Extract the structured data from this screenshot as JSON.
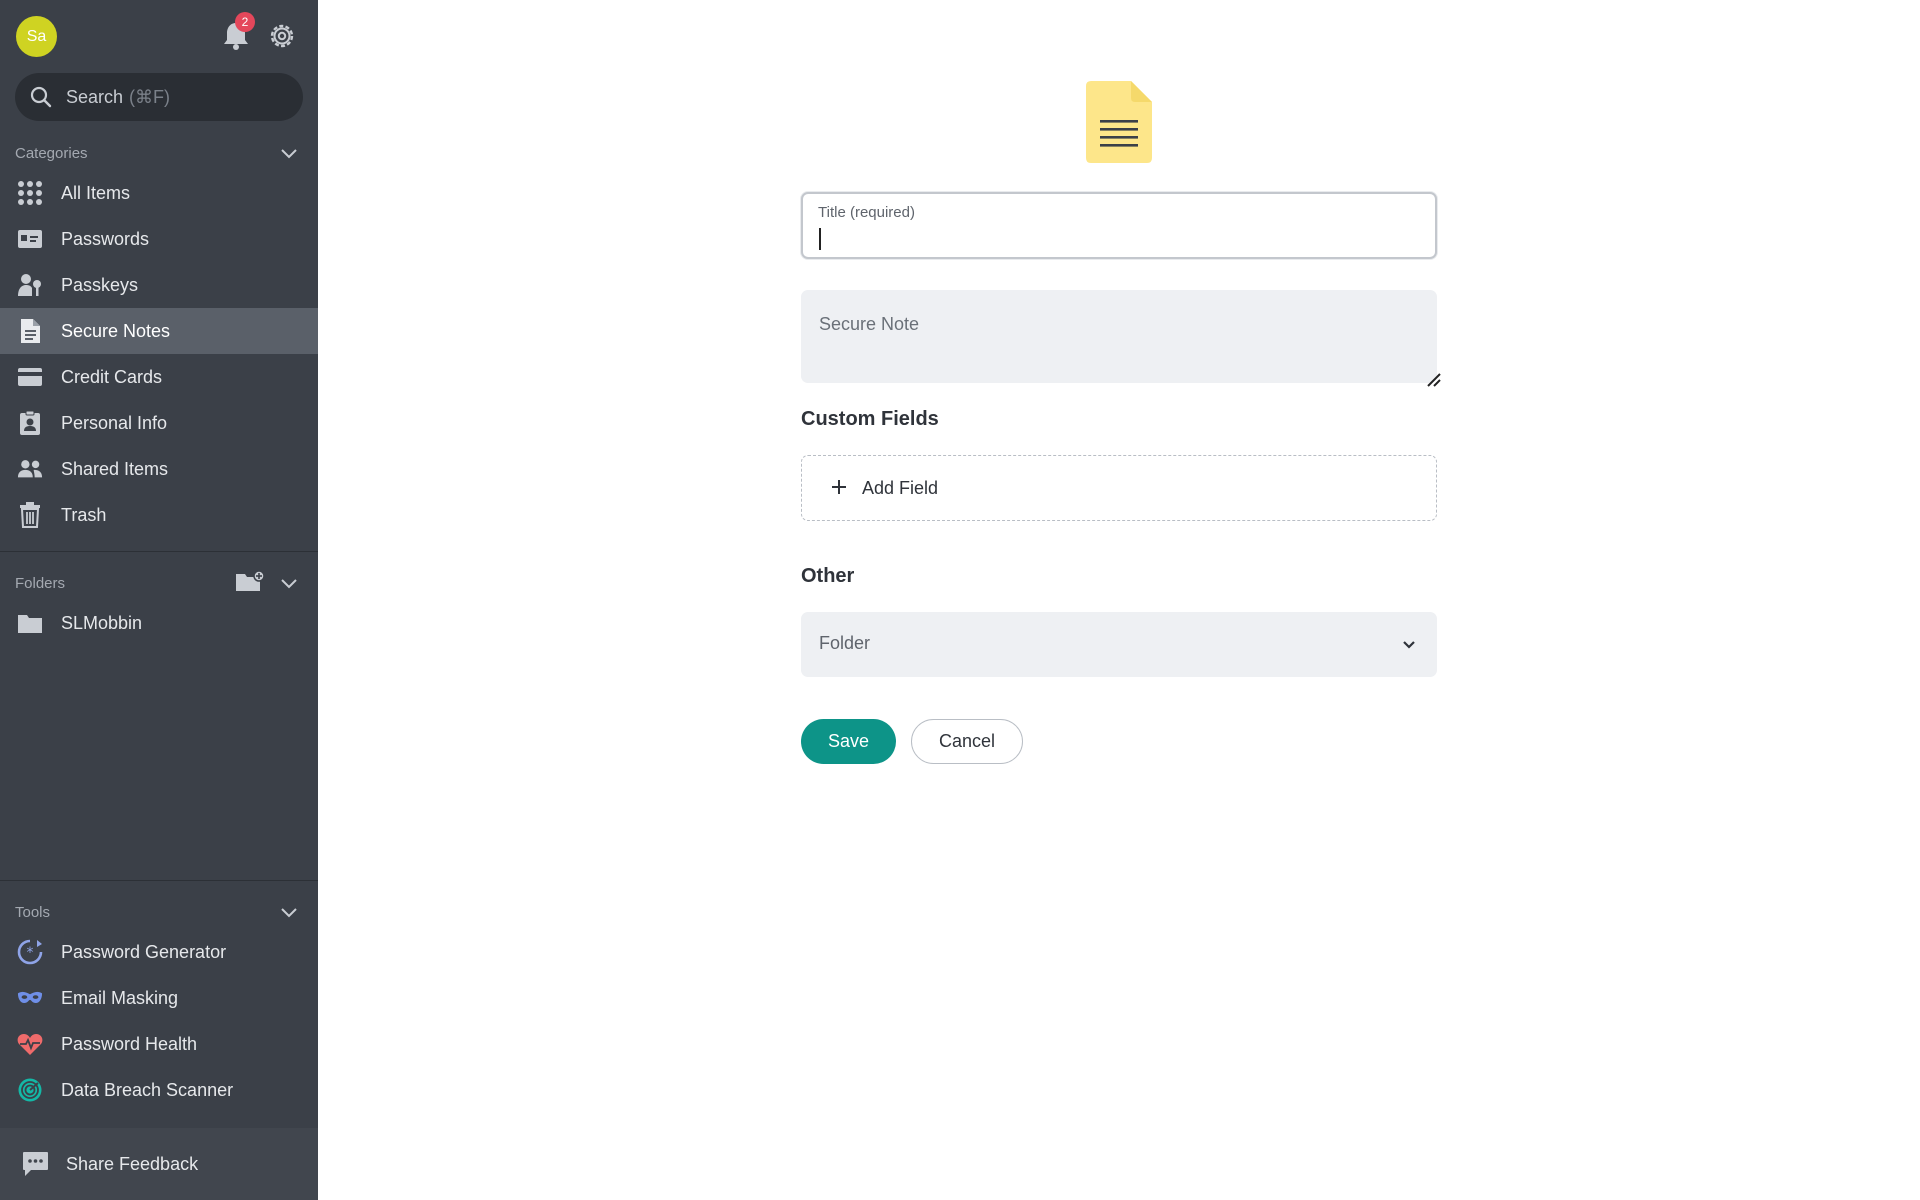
{
  "user": {
    "initials": "Sa",
    "avatar_color": "#cfd322"
  },
  "notifications": {
    "count": "2",
    "badge_color": "#e4475b"
  },
  "search": {
    "placeholder": "Search",
    "shortcut": "(⌘F)"
  },
  "categories": {
    "heading": "Categories",
    "items": [
      {
        "label": "All Items",
        "icon": "grid-icon"
      },
      {
        "label": "Passwords",
        "icon": "password-card-icon"
      },
      {
        "label": "Passkeys",
        "icon": "passkey-icon"
      },
      {
        "label": "Secure Notes",
        "icon": "note-icon",
        "active": true
      },
      {
        "label": "Credit Cards",
        "icon": "credit-card-icon"
      },
      {
        "label": "Personal Info",
        "icon": "id-badge-icon"
      },
      {
        "label": "Shared Items",
        "icon": "people-icon"
      },
      {
        "label": "Trash",
        "icon": "trash-icon"
      }
    ]
  },
  "folders": {
    "heading": "Folders",
    "items": [
      {
        "label": "SLMobbin",
        "icon": "folder-icon"
      }
    ]
  },
  "tools": {
    "heading": "Tools",
    "items": [
      {
        "label": "Password Generator",
        "icon": "password-generator-icon"
      },
      {
        "label": "Email Masking",
        "icon": "mask-icon"
      },
      {
        "label": "Password Health",
        "icon": "heart-pulse-icon"
      },
      {
        "label": "Data Breach Scanner",
        "icon": "radar-icon"
      }
    ]
  },
  "feedback": {
    "label": "Share Feedback"
  },
  "form": {
    "title_label": "Title (required)",
    "title_value": "",
    "note_placeholder": "Secure Note",
    "custom_fields_heading": "Custom Fields",
    "add_field_label": "Add Field",
    "other_heading": "Other",
    "folder_placeholder": "Folder",
    "save_label": "Save",
    "cancel_label": "Cancel"
  },
  "colors": {
    "sidebar_bg": "#3b4048",
    "active_item_bg": "#5a6069",
    "save_button": "#0d9488",
    "note_icon": "#fde68a"
  }
}
